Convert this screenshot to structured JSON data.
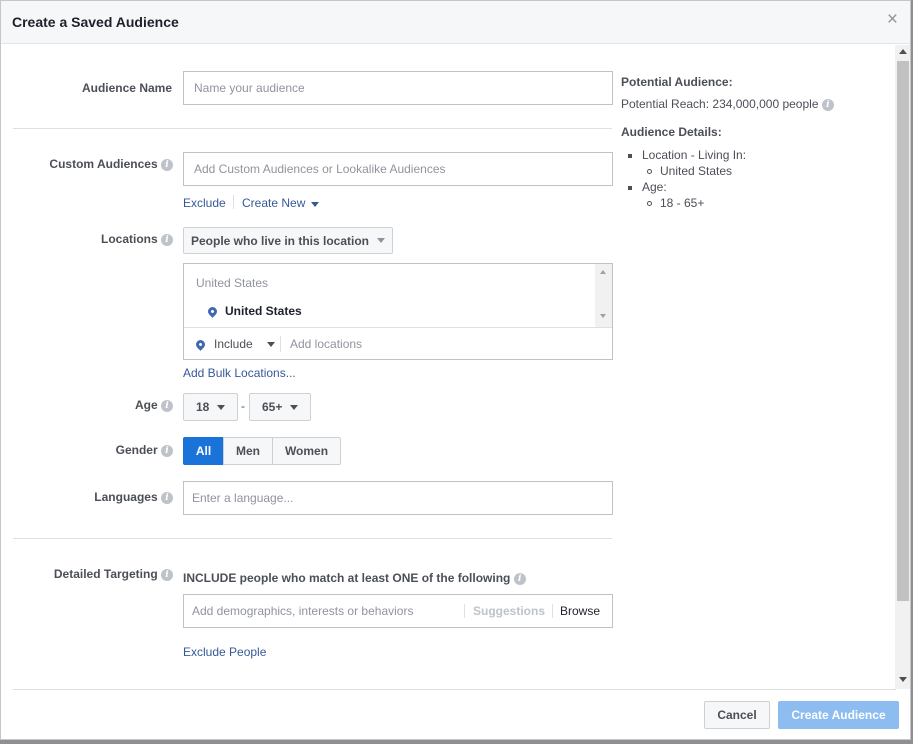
{
  "dialog": {
    "title": "Create a Saved Audience",
    "close_glyph": "×"
  },
  "form": {
    "audience_name": {
      "label": "Audience Name",
      "placeholder": "Name your audience"
    },
    "custom_audiences": {
      "label": "Custom Audiences",
      "placeholder": "Add Custom Audiences or Lookalike Audiences",
      "exclude_link": "Exclude",
      "create_new_link": "Create New"
    },
    "locations": {
      "label": "Locations",
      "dropdown_value": "People who live in this location",
      "list_header": "United States",
      "selected_item": "United States",
      "include_value": "Include",
      "add_placeholder": "Add locations",
      "bulk_link": "Add Bulk Locations..."
    },
    "age": {
      "label": "Age",
      "min": "18",
      "separator": "-",
      "max": "65+"
    },
    "gender": {
      "label": "Gender",
      "options": [
        "All",
        "Men",
        "Women"
      ],
      "selected": "All"
    },
    "languages": {
      "label": "Languages",
      "placeholder": "Enter a language..."
    },
    "detailed_targeting": {
      "label": "Detailed Targeting",
      "heading": "INCLUDE people who match at least ONE of the following",
      "placeholder": "Add demographics, interests or behaviors",
      "suggestions": "Suggestions",
      "browse": "Browse",
      "exclude_link": "Exclude People"
    }
  },
  "sidebar": {
    "potential_title": "Potential Audience:",
    "potential_reach": "Potential Reach: 234,000,000 people",
    "details_title": "Audience Details:",
    "location_item": "Location - Living In:",
    "location_value": "United States",
    "age_item": "Age:",
    "age_value": "18 - 65+"
  },
  "footer": {
    "cancel": "Cancel",
    "create": "Create Audience"
  },
  "colors": {
    "primary": "#1a73d9",
    "link": "#365899",
    "disabled_primary": "#8dbcf0"
  }
}
